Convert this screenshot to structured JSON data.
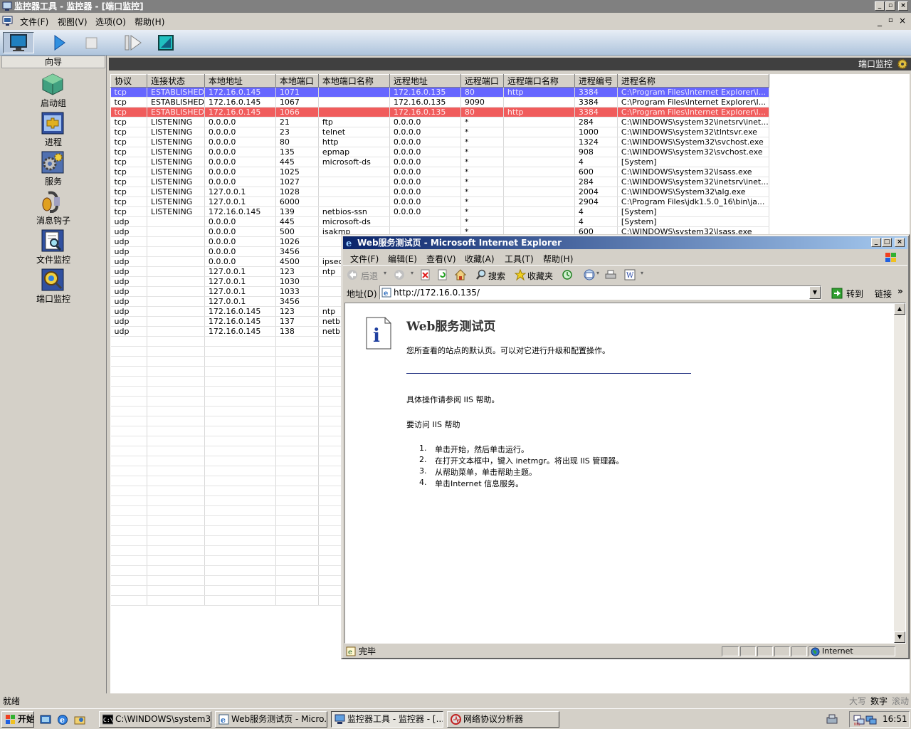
{
  "app": {
    "title": "监控器工具 - 监控器 - [端口监控]",
    "menu": [
      "文件(F)",
      "视图(V)",
      "选项(O)",
      "帮助(H)"
    ],
    "mdi_controls": [
      "_",
      "▫",
      "×"
    ]
  },
  "sidebar": {
    "header": "向导",
    "items": [
      {
        "label": "启动组",
        "icon": "cube-group-icon"
      },
      {
        "label": "进程",
        "icon": "process-puzzle-icon"
      },
      {
        "label": "服务",
        "icon": "service-gears-icon"
      },
      {
        "label": "消息钩子",
        "icon": "message-hook-icon"
      },
      {
        "label": "文件监控",
        "icon": "file-monitor-icon"
      },
      {
        "label": "端口监控",
        "icon": "port-monitor-icon"
      }
    ]
  },
  "panel": {
    "title": "端口监控"
  },
  "grid": {
    "columns": [
      "协议",
      "连接状态",
      "本地地址",
      "本地端口",
      "本地端口名称",
      "远程地址",
      "远程端口",
      "远程端口名称",
      "进程编号",
      "进程名称"
    ],
    "rows": [
      [
        "tcp",
        "ESTABLISHED",
        "172.16.0.145",
        "1071",
        "",
        "172.16.0.135",
        "80",
        "http",
        "3384",
        "C:\\Program Files\\Internet Explorer\\I..."
      ],
      [
        "tcp",
        "ESTABLISHED",
        "172.16.0.145",
        "1067",
        "",
        "172.16.0.135",
        "9090",
        "",
        "3384",
        "C:\\Program Files\\Internet Explorer\\I..."
      ],
      [
        "tcp",
        "ESTABLISHED",
        "172.16.0.145",
        "1066",
        "",
        "172.16.0.135",
        "80",
        "http",
        "3384",
        "C:\\Program Files\\Internet Explorer\\I..."
      ],
      [
        "tcp",
        "LISTENING",
        "0.0.0.0",
        "21",
        "ftp",
        "0.0.0.0",
        "*",
        "",
        "284",
        "C:\\WINDOWS\\system32\\inetsrv\\inet..."
      ],
      [
        "tcp",
        "LISTENING",
        "0.0.0.0",
        "23",
        "telnet",
        "0.0.0.0",
        "*",
        "",
        "1000",
        "C:\\WINDOWS\\system32\\tlntsvr.exe"
      ],
      [
        "tcp",
        "LISTENING",
        "0.0.0.0",
        "80",
        "http",
        "0.0.0.0",
        "*",
        "",
        "1324",
        "C:\\WINDOWS\\System32\\svchost.exe"
      ],
      [
        "tcp",
        "LISTENING",
        "0.0.0.0",
        "135",
        "epmap",
        "0.0.0.0",
        "*",
        "",
        "908",
        "C:\\WINDOWS\\system32\\svchost.exe"
      ],
      [
        "tcp",
        "LISTENING",
        "0.0.0.0",
        "445",
        "microsoft-ds",
        "0.0.0.0",
        "*",
        "",
        "4",
        "[System]"
      ],
      [
        "tcp",
        "LISTENING",
        "0.0.0.0",
        "1025",
        "",
        "0.0.0.0",
        "*",
        "",
        "600",
        "C:\\WINDOWS\\system32\\lsass.exe"
      ],
      [
        "tcp",
        "LISTENING",
        "0.0.0.0",
        "1027",
        "",
        "0.0.0.0",
        "*",
        "",
        "284",
        "C:\\WINDOWS\\system32\\inetsrv\\inet..."
      ],
      [
        "tcp",
        "LISTENING",
        "127.0.0.1",
        "1028",
        "",
        "0.0.0.0",
        "*",
        "",
        "2004",
        "C:\\WINDOWS\\System32\\alg.exe"
      ],
      [
        "tcp",
        "LISTENING",
        "127.0.0.1",
        "6000",
        "",
        "0.0.0.0",
        "*",
        "",
        "2904",
        "C:\\Program Files\\jdk1.5.0_16\\bin\\ja..."
      ],
      [
        "tcp",
        "LISTENING",
        "172.16.0.145",
        "139",
        "netbios-ssn",
        "0.0.0.0",
        "*",
        "",
        "4",
        "[System]"
      ],
      [
        "udp",
        "",
        "0.0.0.0",
        "445",
        "microsoft-ds",
        "",
        "*",
        "",
        "4",
        "[System]"
      ],
      [
        "udp",
        "",
        "0.0.0.0",
        "500",
        "isakmp",
        "",
        "*",
        "",
        "600",
        "C:\\WINDOWS\\system32\\lsass.exe"
      ],
      [
        "udp",
        "",
        "0.0.0.0",
        "1026",
        "",
        "",
        "",
        "",
        "",
        ""
      ],
      [
        "udp",
        "",
        "0.0.0.0",
        "3456",
        "",
        "",
        "",
        "",
        "",
        ""
      ],
      [
        "udp",
        "",
        "0.0.0.0",
        "4500",
        "ipsec",
        "",
        "",
        "",
        "",
        ""
      ],
      [
        "udp",
        "",
        "127.0.0.1",
        "123",
        "ntp",
        "",
        "",
        "",
        "",
        ""
      ],
      [
        "udp",
        "",
        "127.0.0.1",
        "1030",
        "",
        "",
        "",
        "",
        "",
        ""
      ],
      [
        "udp",
        "",
        "127.0.0.1",
        "1033",
        "",
        "",
        "",
        "",
        "",
        ""
      ],
      [
        "udp",
        "",
        "127.0.0.1",
        "3456",
        "",
        "",
        "",
        "",
        "",
        ""
      ],
      [
        "udp",
        "",
        "172.16.0.145",
        "123",
        "ntp",
        "",
        "",
        "",
        "",
        ""
      ],
      [
        "udp",
        "",
        "172.16.0.145",
        "137",
        "netbios",
        "",
        "",
        "",
        "",
        ""
      ],
      [
        "udp",
        "",
        "172.16.0.145",
        "138",
        "netbios",
        "",
        "",
        "",
        "",
        ""
      ]
    ],
    "highlight_colors": {
      "selected_blue": "#6666ff",
      "selected_red": "#f05c5c"
    }
  },
  "ie": {
    "title": "Web服务测试页 - Microsoft Internet Explorer",
    "menu": [
      "文件(F)",
      "编辑(E)",
      "查看(V)",
      "收藏(A)",
      "工具(T)",
      "帮助(H)"
    ],
    "toolbar": {
      "back": "后退",
      "search": "搜索",
      "favorites": "收藏夹"
    },
    "address_label": "地址(D)",
    "address": "http://172.16.0.135/",
    "go": "转到",
    "links": "链接",
    "page": {
      "heading": "Web服务测试页",
      "intro": "您所查看的站点的默认页。可以对它进行升级和配置操作。",
      "see_help": "具体操作请参阅 IIS 帮助。",
      "access_help": "要访问 IIS 帮助",
      "steps": [
        "单击开始，然后单击运行。",
        "在打开文本框中，键入 inetmgr。将出现 IIS 管理器。",
        "从帮助菜单，单击帮助主题。",
        "单击Internet 信息服务。"
      ]
    },
    "status": "完毕",
    "zone": "Internet"
  },
  "statusbar": {
    "left": "就绪",
    "indicators": [
      "大写",
      "数字",
      "滚动"
    ]
  },
  "taskbar": {
    "start": "开始",
    "tasks": [
      {
        "label": "C:\\WINDOWS\\system32...",
        "active": false
      },
      {
        "label": "Web服务测试页 - Micro...",
        "active": false
      },
      {
        "label": "监控器工具 - 监控器 - [...",
        "active": true
      },
      {
        "label": "网络协议分析器",
        "active": false
      }
    ],
    "clock": "16:51"
  }
}
